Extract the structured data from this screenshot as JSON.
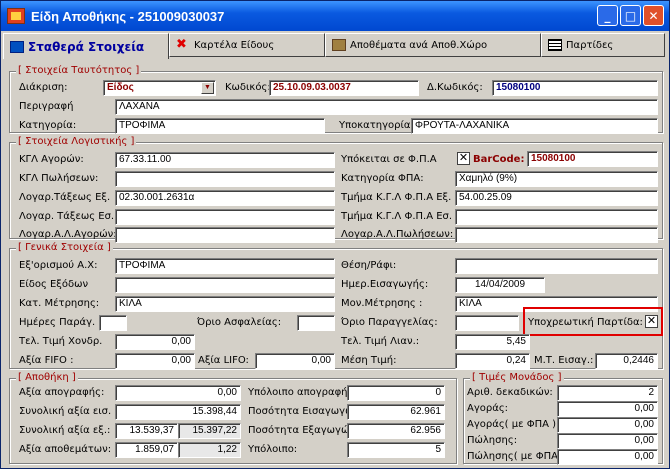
{
  "window": {
    "title": "Είδη Αποθήκης - 251009030037",
    "icon": "warehouse-app-icon",
    "controls": [
      "minimize",
      "maximize",
      "close"
    ]
  },
  "tabs": [
    {
      "label": "Σταθερά Στοιχεία",
      "icon": "book-icon",
      "active": true
    },
    {
      "label": "Καρτέλα Είδους",
      "icon": "red-x-icon"
    },
    {
      "label": "Αποθέματα ανά Αποθ.Χώρο",
      "icon": "boxes-icon"
    },
    {
      "label": "Παρτίδες",
      "icon": "grid-icon"
    }
  ],
  "identity": {
    "legend": "[ Στοιχεία Ταυτότητος ]",
    "diakrisi_label": "Διάκριση:",
    "diakrisi_value": "Είδος",
    "kodikos_label": "Κωδικός:",
    "kodikos_value": "25.10.09.03.0037",
    "dkodikos_label": "Δ.Κωδικός:",
    "dkodikos_value": "15080100",
    "perigrafi_label": "Περιγραφή",
    "perigrafi_value": "ΛΑΧΑΝΑ",
    "kategoria_label": "Κατηγορία:",
    "kategoria_value": "ΤΡΟΦΙΜΑ",
    "ypokat_label": "Υποκατηγορία:",
    "ypokat_value": "ΦΡΟΥΤΑ-ΛΑΧΑΝΙΚΑ"
  },
  "accounting": {
    "legend": "[ Στοιχεία Λογιστικής ]",
    "kgl_ag_label": "ΚΓΛ Αγορών:",
    "kgl_ag_value": "67.33.11.00",
    "kgl_pol_label": "ΚΓΛ Πωλήσεων:",
    "kgl_pol_value": "",
    "log_ex_label": "Λογαρ.Τάξεως Εξ.",
    "log_ex_value": "02.30.001.2631α",
    "log_es_label": "Λογαρ. Τάξεως Εσ.",
    "log_es_value": "",
    "log_aa_label": "Λογαρ.Α.Λ.Αγορών:",
    "log_aa_value": "",
    "fpa_label": "Υπόκειται σε Φ.Π.Α",
    "barcode_label": "BarCode:",
    "barcode_value": "15080100",
    "fpa_checked": true,
    "katfpa_label": "Κατηγορία ΦΠΑ:",
    "katfpa_value": "Χαμηλό (9%)",
    "tm_ex_label": "Τμήμα Κ.Γ.Λ Φ.Π.Α Εξ.",
    "tm_ex_value": "54.00.25.09",
    "tm_es_label": "Τμήμα Κ.Γ.Λ Φ.Π.Α Εσ.",
    "tm_es_value": "",
    "log_ap_label": "Λογαρ.Α.Λ.Πωλήσεων:",
    "log_ap_value": ""
  },
  "general": {
    "legend": "[ Γενικά Στοιχεία ]",
    "exor_label": "Εξ'ορισμού Α.Χ:",
    "exor_value": "ΤΡΟΦΙΜΑ",
    "eidos_exodon_label": "Είδος Εξόδων",
    "eidos_exodon_value": "",
    "kat_metr_label": "Κατ. Μέτρησης:",
    "kat_metr_value": "ΚΙΛΑ",
    "imeres_label": "Ημέρες Παράγ.",
    "imeres_value": "",
    "orio_asf_label": "Όριο Ασφαλείας:",
    "orio_asf_value": "",
    "tel_xondr_label": "Τελ. Τιμή Χονδρ.",
    "tel_xondr_value": "0,00",
    "axia_fifo_label": "Αξία FIFO :",
    "axia_fifo_value": "0,00",
    "axia_lifo_label": "Αξία LIFO:",
    "axia_lifo_value": "0,00",
    "thesi_label": "Θέση/Ράφι:",
    "thesi_value": "",
    "imer_eis_label": "Ημερ.Εισαγωγής:",
    "imer_eis_value": "14/04/2009",
    "mon_metr_label": "Μον.Μέτρησης :",
    "mon_metr_value": "ΚΙΛΑ",
    "orio_par_label": "Όριο Παραγγελίας:",
    "orio_par_value": "",
    "tel_lian_label": "Τελ. Τιμή Λιαν.:",
    "tel_lian_value": "5,45",
    "mesi_label": "Μέση Τιμή:",
    "mesi_value": "0,24",
    "mt_eis_label": "Μ.Τ. Εισαγ.:",
    "mt_eis_value": "0,2446",
    "partida_label": "Υποχρεωτική Παρτίδα:",
    "partida_checked": true
  },
  "stock": {
    "legend": "[ Αποθήκη ]",
    "axia_apogr_label": "Αξία απογραφής:",
    "axia_apogr_value": "0,00",
    "syn_eis_label": "Συνολική αξία εισ.",
    "syn_eis_value": "15.398,44",
    "syn_ex_label": "Συνολική αξία εξ.:",
    "syn_ex_value1": "13.539,37",
    "syn_ex_value2": "15.397,22",
    "axia_apoth_label": "Αξία αποθεμάτων:",
    "axia_apoth_value1": "1.859,07",
    "axia_apoth_value2": "1,22",
    "ypol_apogr_label": "Υπόλοιπο απογραφής:",
    "ypol_apogr_value": "0",
    "pos_eis_label": "Ποσότητα Εισαγωγών",
    "pos_eis_value": "62.961",
    "pos_ex_label": "Ποσότητα Εξαγωγών",
    "pos_ex_value": "62.956",
    "ypol_label": "Υπόλοιπο:",
    "ypol_value": "5"
  },
  "prices": {
    "legend": "[ Τιμές Μονάδος ]",
    "dekad_label": "Αριθ. δεκαδικών:",
    "dekad_value": "2",
    "agoras_label": "Αγοράς:",
    "agoras_value": "0,00",
    "agoras_fpa_label": "Αγοράς( με ΦΠΑ )",
    "agoras_fpa_value": "0,00",
    "polisis_label": "Πώλησης:",
    "polisis_value": "0,00",
    "polisis_fpa_label": "Πώλησης( με ΦΠΑ )",
    "polisis_fpa_value": "0,00"
  }
}
